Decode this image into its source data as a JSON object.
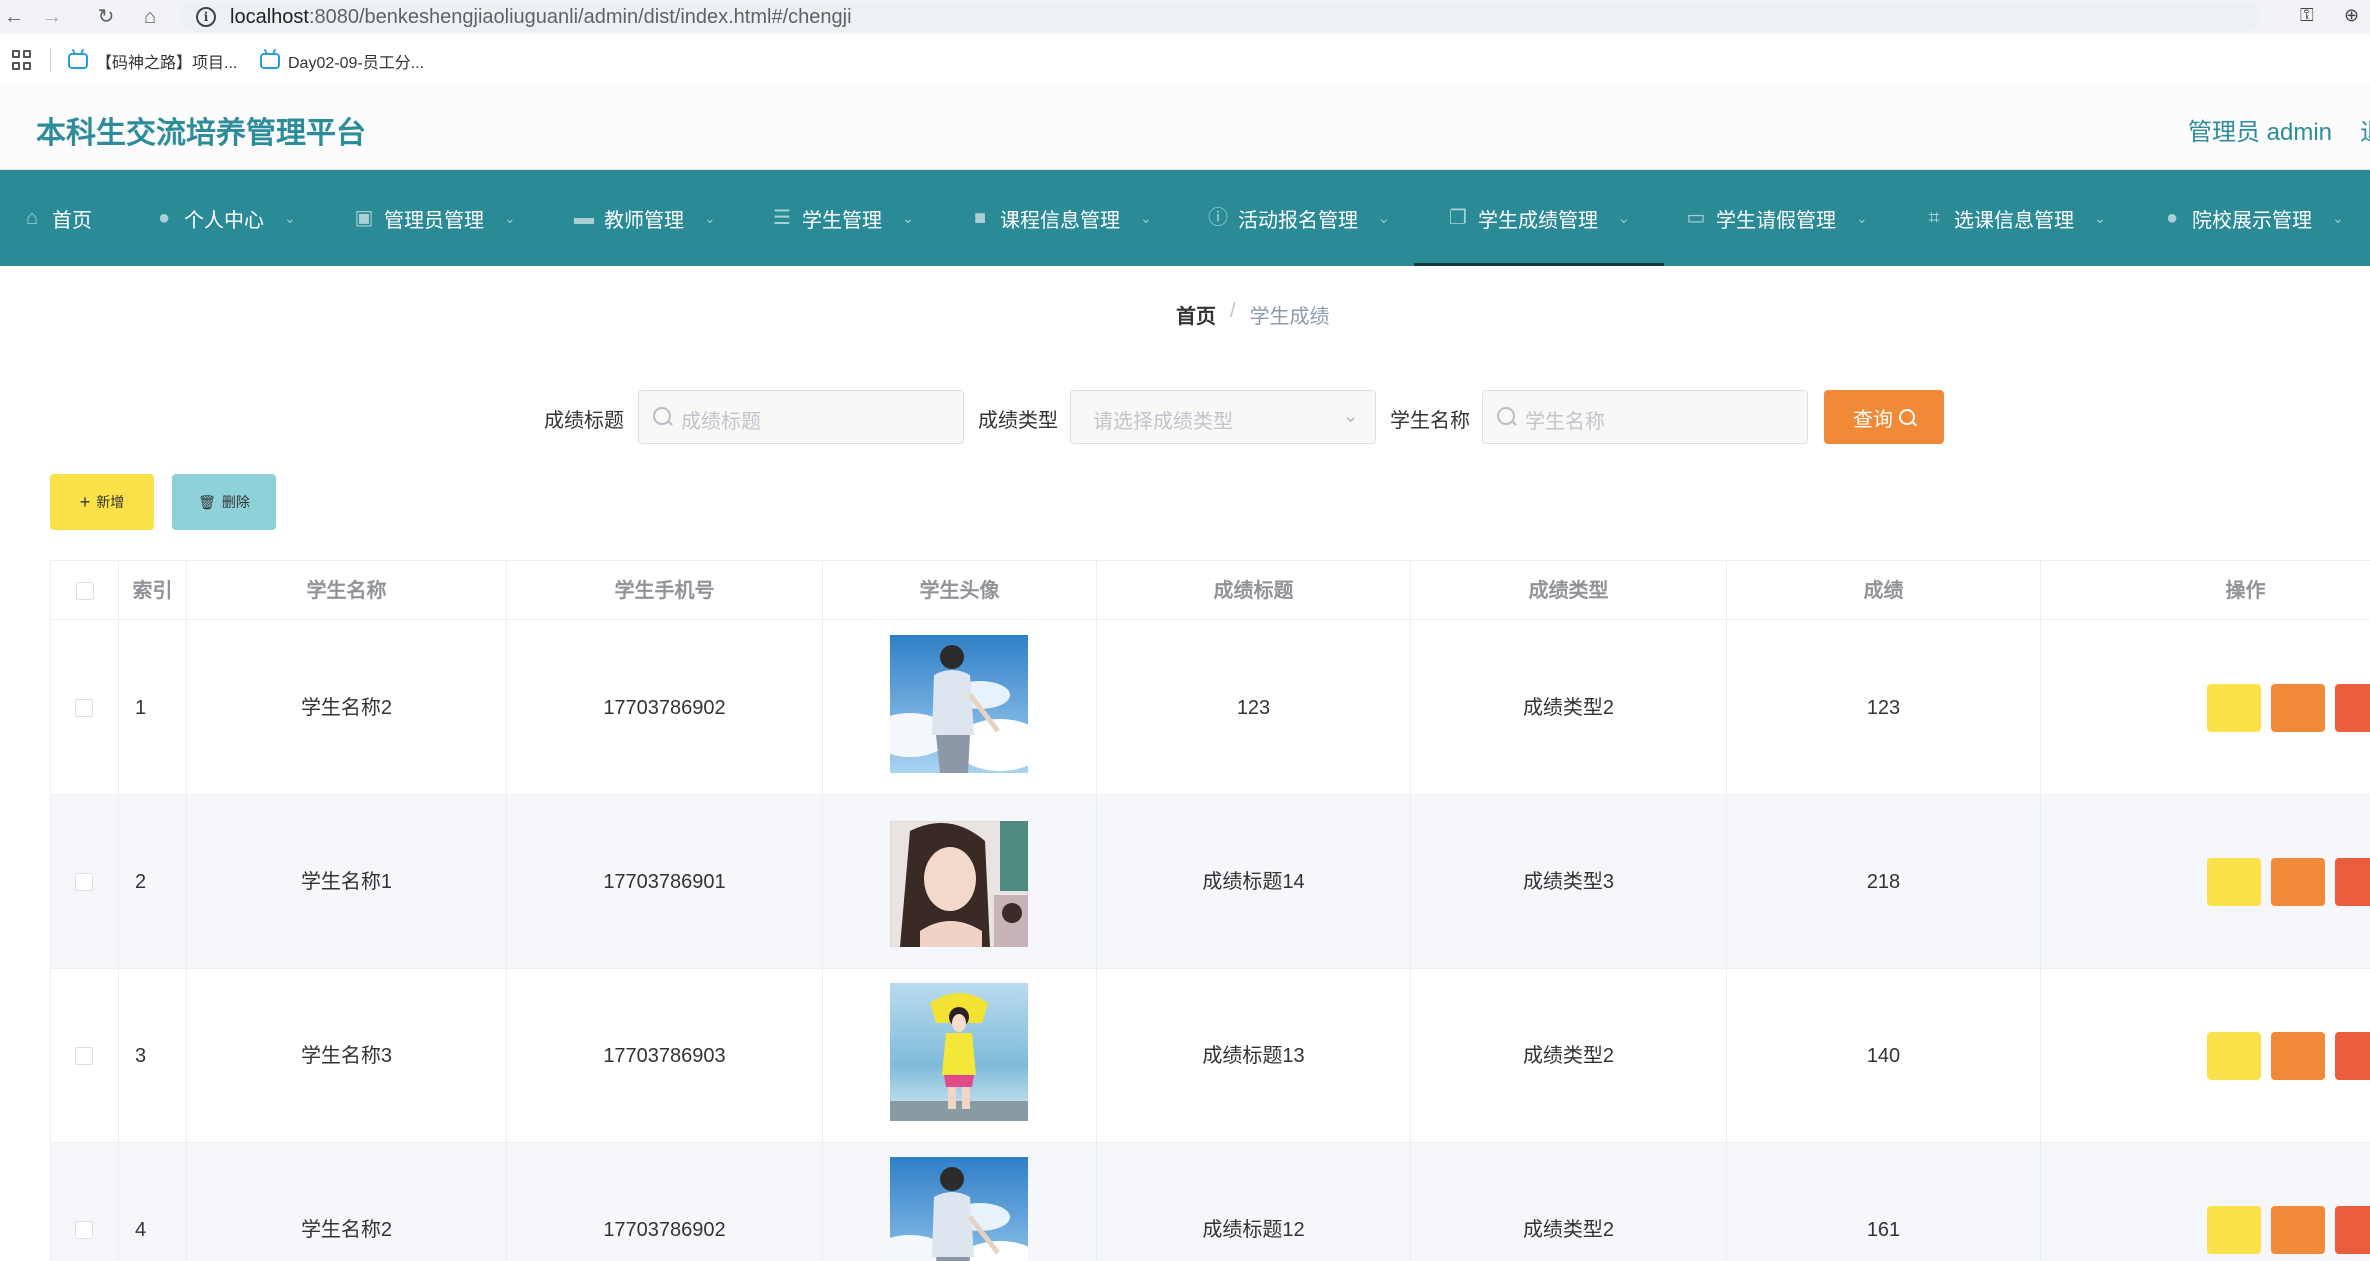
{
  "browser": {
    "url_host": "localhost",
    "url_rest": ":8080/benkeshengjiaoliuguanli/admin/dist/index.html#/chengji",
    "bookmarks": [
      "【码神之路】项目...",
      "Day02-09-员工分..."
    ]
  },
  "header": {
    "title": "本科生交流培养管理平台",
    "user": "管理员 admin",
    "exit": "退"
  },
  "menu": [
    {
      "label": "首页",
      "icon": "home-icon",
      "dropdown": false
    },
    {
      "label": "个人中心",
      "icon": "user-icon",
      "dropdown": true
    },
    {
      "label": "管理员管理",
      "icon": "clipboard-icon",
      "dropdown": true
    },
    {
      "label": "教师管理",
      "icon": "chat-icon",
      "dropdown": true
    },
    {
      "label": "学生管理",
      "icon": "sliders-icon",
      "dropdown": true
    },
    {
      "label": "课程信息管理",
      "icon": "briefcase-icon",
      "dropdown": true
    },
    {
      "label": "活动报名管理",
      "icon": "info-icon",
      "dropdown": true
    },
    {
      "label": "学生成绩管理",
      "icon": "copy-icon",
      "dropdown": true,
      "active": true
    },
    {
      "label": "学生请假管理",
      "icon": "monitor-icon",
      "dropdown": true
    },
    {
      "label": "选课信息管理",
      "icon": "crop-icon",
      "dropdown": true
    },
    {
      "label": "院校展示管理",
      "icon": "location-icon",
      "dropdown": true
    }
  ],
  "breadcrumb": {
    "home": "首页",
    "separator": "/",
    "current": "学生成绩"
  },
  "search": {
    "title_label": "成绩标题",
    "title_placeholder": "成绩标题",
    "type_label": "成绩类型",
    "type_placeholder": "请选择成绩类型",
    "name_label": "学生名称",
    "name_placeholder": "学生名称",
    "query_label": "查询"
  },
  "actions": {
    "add_label": "新增",
    "delete_label": "删除"
  },
  "table": {
    "columns": [
      "索引",
      "学生名称",
      "学生手机号",
      "学生头像",
      "成绩标题",
      "成绩类型",
      "成绩",
      "操作"
    ],
    "rows": [
      {
        "index": "1",
        "name": "学生名称2",
        "phone": "17703786902",
        "avatar": "boy-sky-photo",
        "title": "123",
        "type": "成绩类型2",
        "score": "123"
      },
      {
        "index": "2",
        "name": "学生名称1",
        "phone": "17703786901",
        "avatar": "girl-portrait-photo",
        "title": "成绩标题14",
        "type": "成绩类型3",
        "score": "218"
      },
      {
        "index": "3",
        "name": "学生名称3",
        "phone": "17703786903",
        "avatar": "girl-sea-photo",
        "title": "成绩标题13",
        "type": "成绩类型2",
        "score": "140"
      },
      {
        "index": "4",
        "name": "学生名称2",
        "phone": "17703786902",
        "avatar": "boy-sky-photo",
        "title": "成绩标题12",
        "type": "成绩类型2",
        "score": "161"
      }
    ]
  },
  "colors": {
    "primary": "#2a8a96",
    "title": "#2c8c9a",
    "query": "#f08a36",
    "add": "#fbe24a",
    "delete": "#8fd1d8",
    "op_edit": "#fbe24a",
    "op_view": "#f08a36",
    "op_delete": "#ec5d3e"
  }
}
